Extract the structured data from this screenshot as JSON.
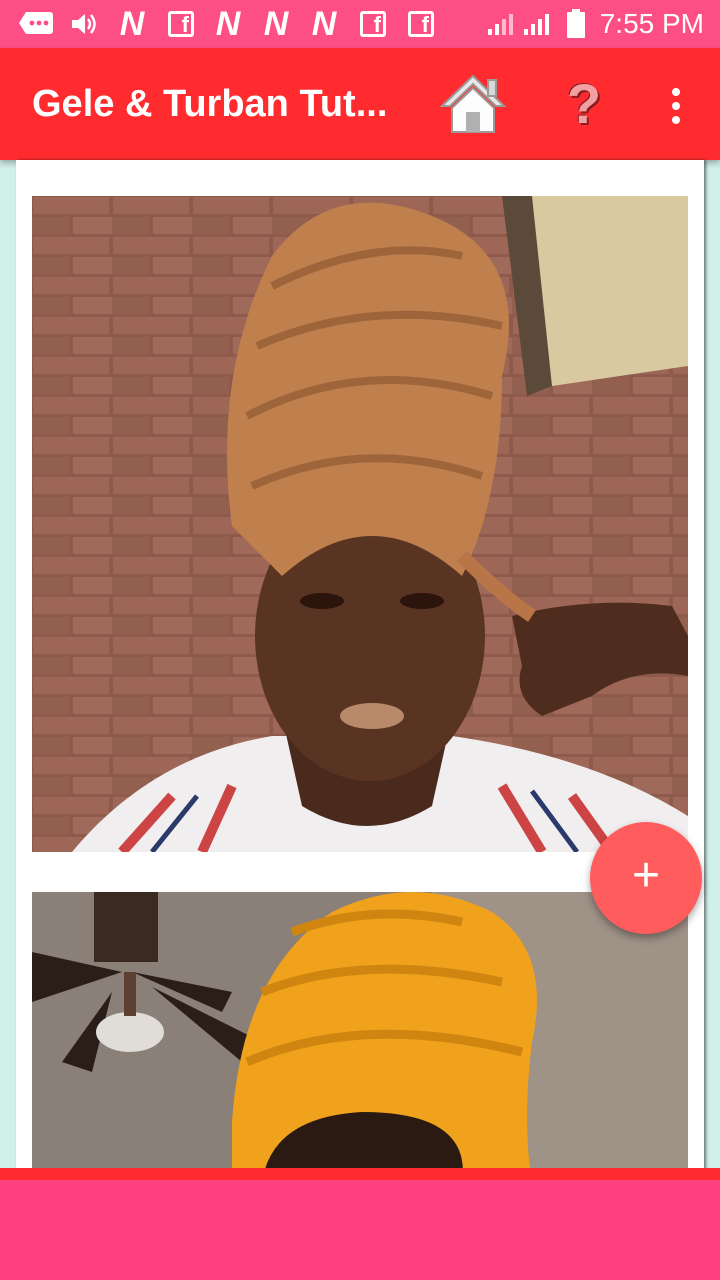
{
  "status_bar": {
    "time": "7:55 PM",
    "notification_letters": [
      "N",
      "N",
      "N",
      "N"
    ],
    "fb_letter": "f",
    "icons": [
      "message-icon",
      "volume-icon",
      "n-notification-icon",
      "facebook-icon",
      "signal-icon",
      "battery-icon"
    ],
    "battery_level": 1.0
  },
  "app_bar": {
    "title": "Gele & Turban Tut...",
    "help_label": "?",
    "icons": [
      "home-icon",
      "help-icon",
      "more-vert-icon"
    ]
  },
  "feed": {
    "cards": [
      {
        "subject": "photo of woman wearing tan head wrap"
      },
      {
        "subject": "photo of woman wearing mustard yellow head wrap"
      }
    ]
  },
  "fab": {
    "label": "+"
  },
  "colors": {
    "status_bar": "#fe4e86",
    "app_bar": "#ff2b2e",
    "fab": "#ff5d5d",
    "background": "#d2f0ea",
    "nav_bar": "#fe4080"
  }
}
